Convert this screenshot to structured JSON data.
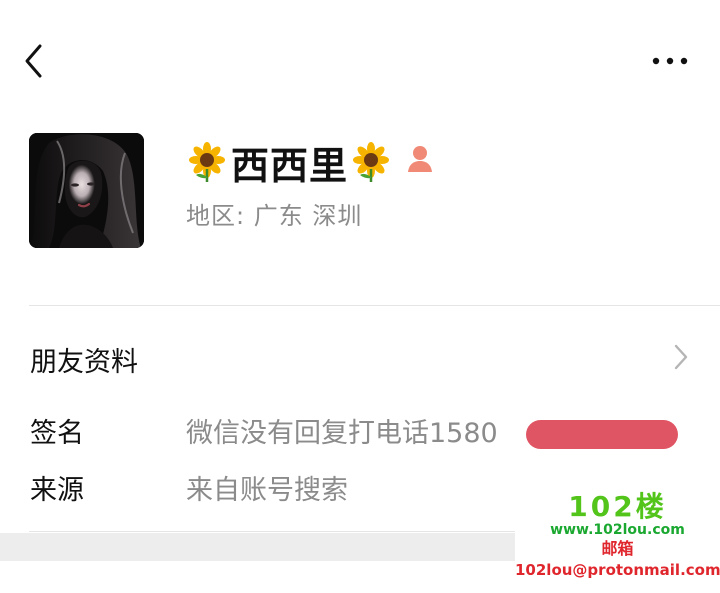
{
  "header": {
    "back_icon": "chevron-left-icon",
    "more_icon": "more-horizontal-icon"
  },
  "profile": {
    "avatar_icon": "avatar-photo",
    "name": "西西里",
    "name_emoji": "sunflower",
    "gender_icon": "female-icon",
    "gender_color": "#f08a76",
    "region": "地区: 广东 深圳"
  },
  "rows": {
    "friend_info_label": "朋友资料",
    "signature_label": "签名",
    "signature_value": "微信没有回复打电话1580",
    "source_label": "来源",
    "source_value": "来自账号搜索"
  },
  "watermark": {
    "logo": "102楼",
    "url": "www.102lou.com",
    "mail_label": "邮箱",
    "email": "102lou@protonmail.com",
    "green": "#52c41a",
    "red": "#e0262d"
  },
  "colors": {
    "redaction": "#e05563",
    "secondary_text": "#8b8b8b"
  }
}
